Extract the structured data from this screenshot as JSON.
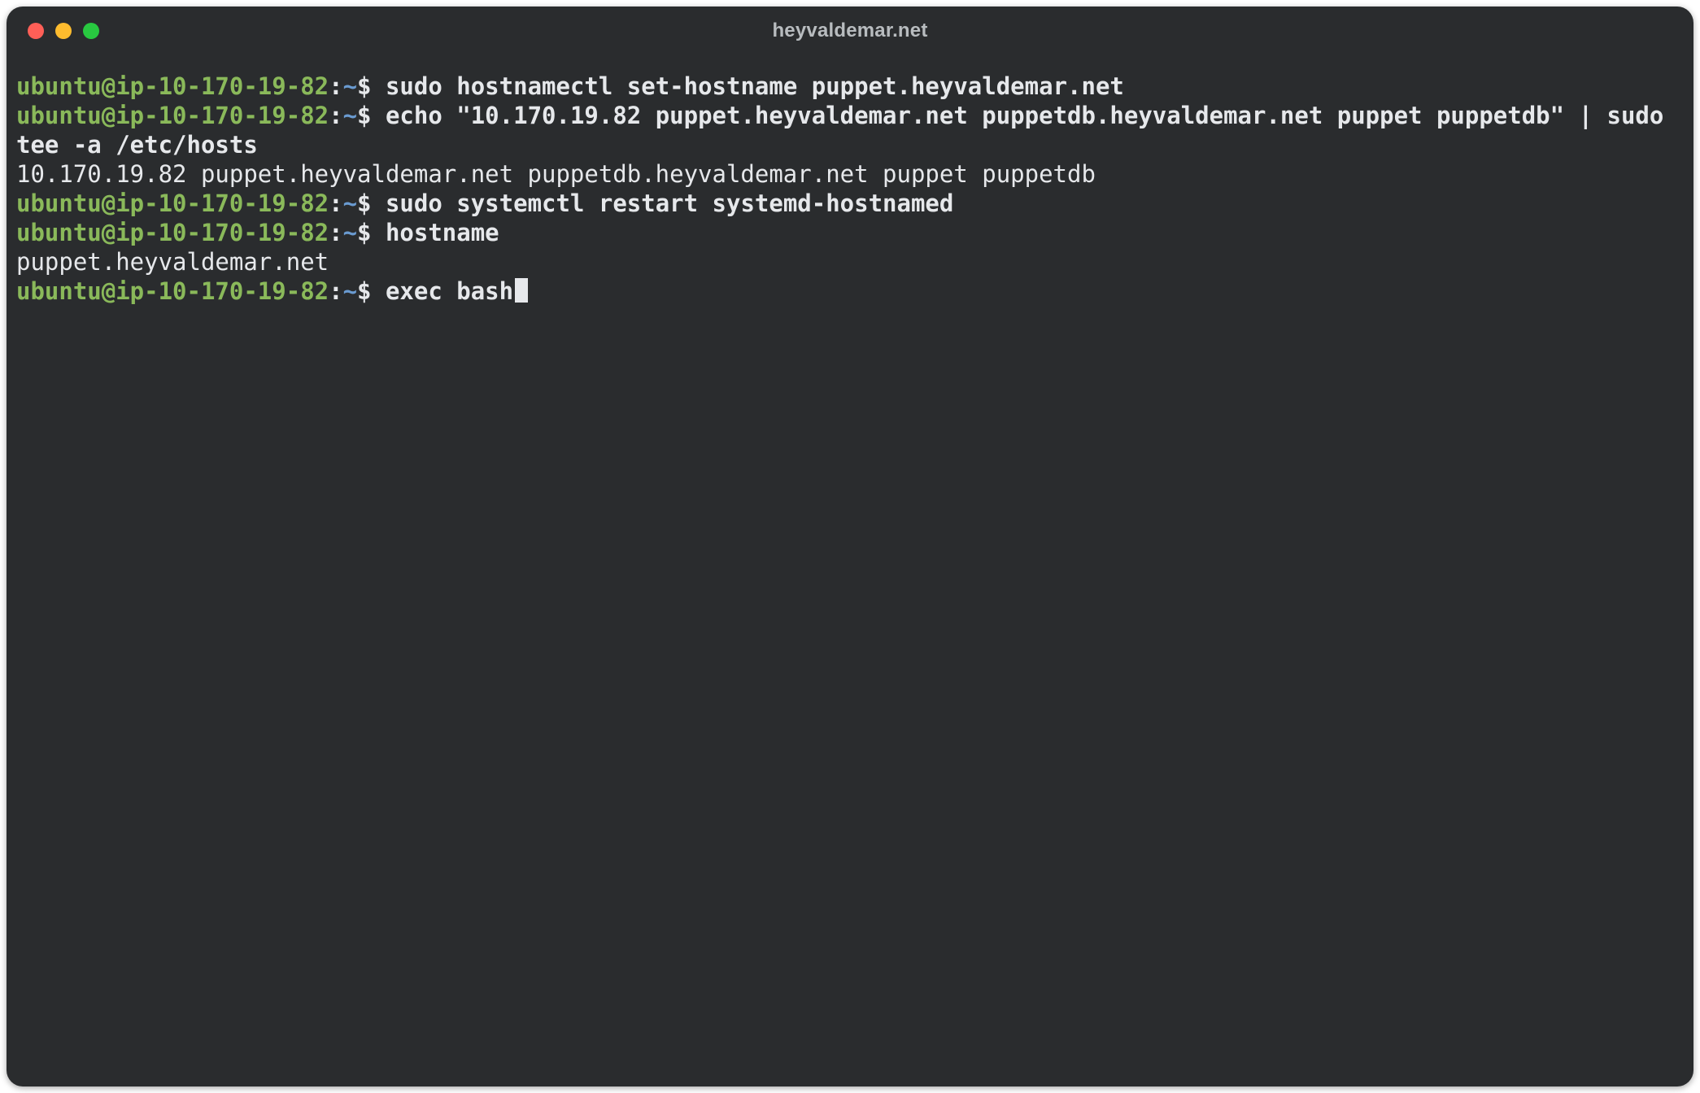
{
  "window": {
    "title": "heyvaldemar.net",
    "traffic_light_colors": {
      "close": "#ff5f57",
      "minimize": "#febc2e",
      "zoom": "#28c840"
    }
  },
  "prompt": {
    "user_host": "ubuntu@ip-10-170-19-82",
    "sep1": ":",
    "path": "~",
    "sep2": "$ "
  },
  "lines": [
    {
      "type": "cmd",
      "command": "sudo hostnamectl set-hostname puppet.heyvaldemar.net"
    },
    {
      "type": "cmd",
      "command": "echo \"10.170.19.82 puppet.heyvaldemar.net puppetdb.heyvaldemar.net puppet puppetdb\" | sudo tee -a /etc/hosts"
    },
    {
      "type": "out",
      "text": "10.170.19.82 puppet.heyvaldemar.net puppetdb.heyvaldemar.net puppet puppetdb"
    },
    {
      "type": "cmd",
      "command": "sudo systemctl restart systemd-hostnamed"
    },
    {
      "type": "cmd",
      "command": "hostname"
    },
    {
      "type": "out",
      "text": "puppet.heyvaldemar.net"
    },
    {
      "type": "cmd_cursor",
      "command": "exec bash"
    }
  ]
}
